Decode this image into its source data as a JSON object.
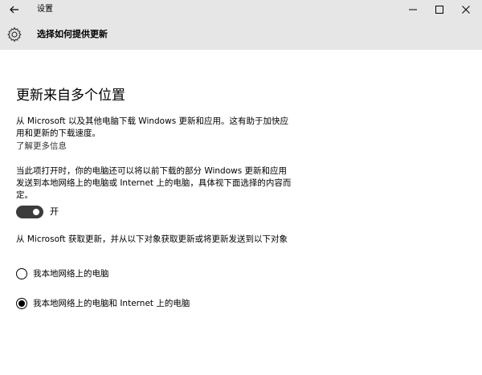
{
  "window": {
    "title": "设置"
  },
  "header": {
    "title": "选择如何提供更新"
  },
  "main": {
    "section_title": "更新来自多个位置",
    "paragraph1": "从 Microsoft 以及其他电脑下载 Windows 更新和应用。这有助于加快应用和更新的下载速度。",
    "learn_more_link": "了解更多信息",
    "paragraph2": "当此项打开时，你的电脑还可以将以前下载的部分 Windows 更新和应用发送到本地网络上的电脑或 Internet 上的电脑，具体视下面选择的内容而定。",
    "toggle": {
      "state": "on",
      "label": "开"
    },
    "paragraph3": "从 Microsoft 获取更新，并从以下对象获取更新或将更新发送到以下对象",
    "options": [
      {
        "label": "我本地网络上的电脑",
        "selected": false
      },
      {
        "label": "我本地网络上的电脑和 Internet 上的电脑",
        "selected": true
      }
    ]
  },
  "icons": {
    "back": "back-arrow-icon",
    "settings": "gear-icon",
    "minimize": "minimize-icon",
    "maximize": "maximize-icon",
    "close": "close-icon"
  },
  "colors": {
    "titlebar_bg": "#e6e6e6",
    "toggle_on": "#3c3c3c",
    "text": "#000000"
  }
}
